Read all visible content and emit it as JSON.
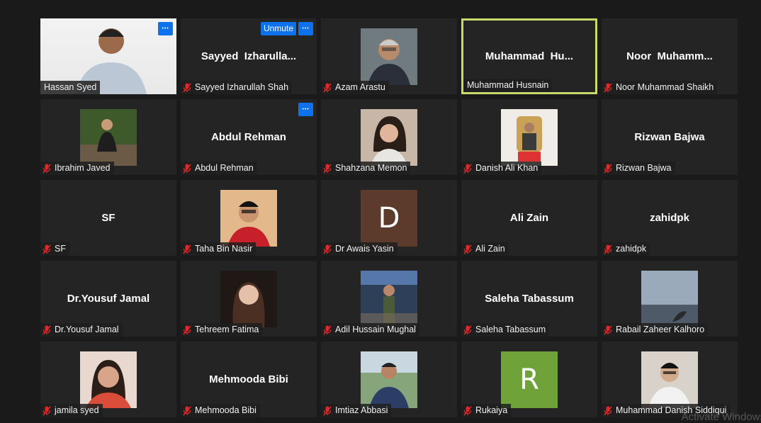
{
  "participants": [
    {
      "name": "Hassan Syed",
      "tile": "",
      "muted": false,
      "video": "photo-hassan",
      "dots": true,
      "unmute": ""
    },
    {
      "name": "Sayyed Izharullah Shah",
      "tile": "Sayyed  Izharulla...",
      "muted": true,
      "video": "",
      "dots": true,
      "unmute": "Unmute"
    },
    {
      "name": "Azam Arastu",
      "tile": "",
      "muted": true,
      "video": "photo-azam",
      "dots": false,
      "unmute": ""
    },
    {
      "name": "Muhammad Husnain",
      "tile": "Muhammad  Hu...",
      "muted": false,
      "video": "",
      "active": true,
      "dots": false,
      "unmute": ""
    },
    {
      "name": "Noor Muhammad Shaikh",
      "tile": "Noor  Muhamm...",
      "muted": true,
      "video": "",
      "dots": false,
      "unmute": ""
    },
    {
      "name": "Ibrahim Javed",
      "tile": "",
      "muted": true,
      "video": "photo-ibrahim",
      "dots": false,
      "unmute": ""
    },
    {
      "name": "Abdul Rehman",
      "tile": "Abdul Rehman",
      "muted": true,
      "video": "",
      "dots": true,
      "unmute": ""
    },
    {
      "name": "Shahzana Memon",
      "tile": "",
      "muted": true,
      "video": "photo-shahzana",
      "dots": false,
      "unmute": ""
    },
    {
      "name": "Danish Ali Khan",
      "tile": "",
      "muted": true,
      "video": "photo-danish",
      "dots": false,
      "unmute": ""
    },
    {
      "name": "Rizwan Bajwa",
      "tile": "Rizwan Bajwa",
      "muted": true,
      "video": "",
      "dots": false,
      "unmute": ""
    },
    {
      "name": "SF",
      "tile": "SF",
      "muted": true,
      "video": "",
      "dots": false,
      "unmute": ""
    },
    {
      "name": "Taha Bin Nasir",
      "tile": "",
      "muted": true,
      "video": "photo-taha",
      "dots": false,
      "unmute": ""
    },
    {
      "name": "Dr Awais Yasin",
      "tile": "",
      "muted": true,
      "video": "",
      "avatar": "D",
      "avatar_color": "#5c3a2c",
      "dots": false,
      "unmute": ""
    },
    {
      "name": "Ali Zain",
      "tile": "Ali Zain",
      "muted": true,
      "video": "",
      "dots": false,
      "unmute": ""
    },
    {
      "name": "zahidpk",
      "tile": "zahidpk",
      "muted": true,
      "video": "",
      "dots": false,
      "unmute": ""
    },
    {
      "name": "Dr.Yousuf Jamal",
      "tile": "Dr.Yousuf Jamal",
      "muted": true,
      "video": "",
      "dots": false,
      "unmute": ""
    },
    {
      "name": "Tehreem Fatima",
      "tile": "",
      "muted": true,
      "video": "photo-tehreem",
      "dots": false,
      "unmute": ""
    },
    {
      "name": "Adil Hussain Mughal",
      "tile": "",
      "muted": true,
      "video": "photo-adil",
      "dots": false,
      "unmute": ""
    },
    {
      "name": "Saleha Tabassum",
      "tile": "Saleha Tabassum",
      "muted": true,
      "video": "",
      "dots": false,
      "unmute": ""
    },
    {
      "name": "Rabail Zaheer Kalhoro",
      "tile": "",
      "muted": true,
      "video": "photo-rabail",
      "dots": false,
      "unmute": ""
    },
    {
      "name": "jamila syed",
      "tile": "",
      "muted": true,
      "video": "photo-jamila",
      "dots": false,
      "unmute": ""
    },
    {
      "name": "Mehmooda Bibi",
      "tile": "Mehmooda Bibi",
      "muted": true,
      "video": "",
      "dots": false,
      "unmute": ""
    },
    {
      "name": "Imtiaz Abbasi",
      "tile": "",
      "muted": true,
      "video": "photo-imtiaz",
      "dots": false,
      "unmute": ""
    },
    {
      "name": "Rukaiya",
      "tile": "",
      "muted": true,
      "video": "",
      "avatar": "R",
      "avatar_color": "#6fa33a",
      "dots": false,
      "unmute": ""
    },
    {
      "name": "Muhammad Danish Siddiqui",
      "tile": "",
      "muted": true,
      "video": "photo-msiddiqui",
      "dots": false,
      "unmute": ""
    }
  ],
  "watermark": "Activate Windows",
  "colors": {
    "accent": "#0e72ed",
    "active_border": "#c9d96b",
    "tile_bg": "#242424",
    "muted_red": "#e02828"
  }
}
